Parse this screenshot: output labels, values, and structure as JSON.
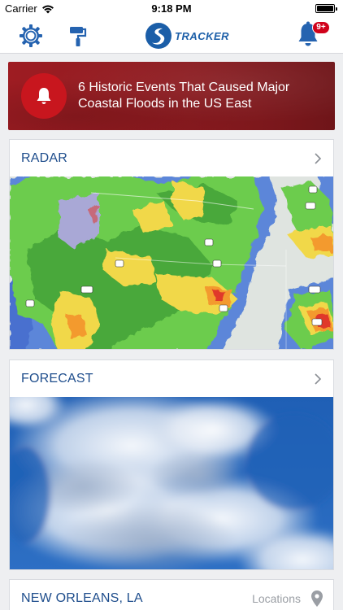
{
  "status_bar": {
    "carrier": "Carrier",
    "time": "9:18 PM"
  },
  "nav": {
    "logo_text": "TRACKER",
    "notification_badge": "9+",
    "icons": [
      "gear-icon",
      "paint-roller-icon",
      "bell-icon"
    ]
  },
  "alert": {
    "text": "6 Historic Events That Caused Major Coastal Floods in the US East",
    "icon": "bell-icon"
  },
  "radar": {
    "title": "RADAR"
  },
  "forecast": {
    "title": "FORECAST"
  },
  "location": {
    "name": "NEW ORLEANS, LA",
    "locations_label": "Locations"
  },
  "colors": {
    "accent_blue": "#1e4d8c",
    "alert_red": "#9e1c22",
    "badge_red": "#d0021b"
  }
}
